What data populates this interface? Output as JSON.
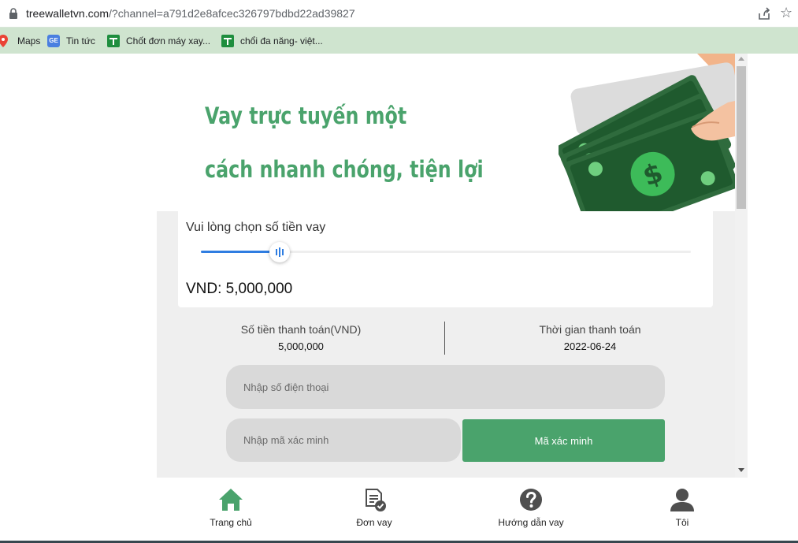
{
  "browser": {
    "url_host": "treewalletvn.com",
    "url_path": "/?channel=a791d2e8afcec326797bdbd22ad39827",
    "bookmarks": [
      {
        "label": "Maps",
        "icon": "maps-pin-icon"
      },
      {
        "label": "Tin tức",
        "icon": "google-news-icon"
      },
      {
        "label": "Chốt đơn máy xay...",
        "icon": "google-sheets-icon"
      },
      {
        "label": "chổi đa năng- việt...",
        "icon": "google-sheets-icon"
      }
    ],
    "news_icon_text": "GE"
  },
  "hero": {
    "line1": "Vay trực tuyến một",
    "line2": "cách nhanh chóng, tiện lợi",
    "illustration": "money-in-hand-icon"
  },
  "loan": {
    "prompt": "Vui lòng chọn số tiền vay",
    "slider_fraction": 0.16,
    "amount_display": "VND: 5,000,000"
  },
  "summary": {
    "payment_label": "Số tiền thanh toán(VND)",
    "payment_value": "5,000,000",
    "date_label": "Thời gian thanh toán",
    "date_value": "2022-06-24"
  },
  "form": {
    "phone_placeholder": "Nhập số điện thoại",
    "code_placeholder": "Nhập mã xác minh",
    "code_button": "Mã xác minh"
  },
  "nav": [
    {
      "label": "Trang chủ",
      "icon": "home-icon"
    },
    {
      "label": "Đơn vay",
      "icon": "document-check-icon"
    },
    {
      "label": "Hướng dẫn vay",
      "icon": "help-circle-icon"
    },
    {
      "label": "Tôi",
      "icon": "user-icon"
    }
  ],
  "colors": {
    "brand_green": "#4aa36c",
    "slider_blue": "#2f7de1",
    "bookmark_bar": "#cfe4cf"
  }
}
